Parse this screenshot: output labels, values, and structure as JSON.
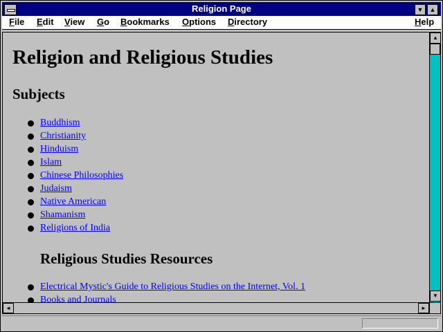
{
  "window": {
    "title": "Religion Page"
  },
  "menu": [
    {
      "label": "File",
      "key": "F",
      "rest": "ile"
    },
    {
      "label": "Edit",
      "key": "E",
      "rest": "dit"
    },
    {
      "label": "View",
      "key": "V",
      "rest": "iew"
    },
    {
      "label": "Go",
      "key": "G",
      "rest": "o"
    },
    {
      "label": "Bookmarks",
      "key": "B",
      "rest": "ookmarks"
    },
    {
      "label": "Options",
      "key": "O",
      "rest": "ptions"
    },
    {
      "label": "Directory",
      "key": "D",
      "rest": "irectory"
    },
    {
      "label": "Help",
      "key": "H",
      "rest": "elp"
    }
  ],
  "page": {
    "title": "Religion and Religious Studies",
    "subjects_heading": "Subjects",
    "subjects": [
      "Buddhism",
      "Christianity",
      "Hinduism",
      "Islam",
      "Chinese Philosophies",
      "Judaism",
      "Native American",
      "Shamanism",
      "Religions of India"
    ],
    "resources_heading": "Religious Studies Resources",
    "resources": [
      "Electrical Mystic's Guide to Religious Studies on the Internet, Vol. 1",
      "Books and Journals"
    ]
  },
  "icons": {
    "minimize": "▼",
    "maximize": "▲",
    "scroll_up": "▲",
    "scroll_down": "▼",
    "scroll_left": "◄",
    "scroll_right": "►"
  },
  "colors": {
    "titlebar": "#000080",
    "link": "#0000ff",
    "scroll_track": "#00c0c0",
    "background": "#c0c0c0"
  }
}
